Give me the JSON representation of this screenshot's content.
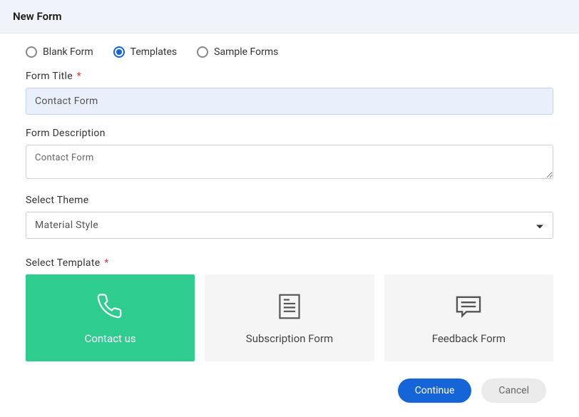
{
  "header": {
    "title": "New Form"
  },
  "formType": {
    "options": [
      {
        "label": "Blank Form",
        "selected": false
      },
      {
        "label": "Templates",
        "selected": true
      },
      {
        "label": "Sample Forms",
        "selected": false
      }
    ]
  },
  "fields": {
    "formTitle": {
      "label": "Form Title",
      "required": true,
      "value": "Contact Form"
    },
    "formDescription": {
      "label": "Form Description",
      "value": "Contact Form"
    },
    "selectTheme": {
      "label": "Select Theme",
      "value": "Material Style"
    },
    "selectTemplate": {
      "label": "Select Template",
      "required": true,
      "options": [
        {
          "name": "Contact us",
          "icon": "phone-icon",
          "selected": true
        },
        {
          "name": "Subscription Form",
          "icon": "document-icon",
          "selected": false
        },
        {
          "name": "Feedback Form",
          "icon": "chat-icon",
          "selected": false
        }
      ]
    }
  },
  "buttons": {
    "continue": "Continue",
    "cancel": "Cancel"
  },
  "requiredMark": "*"
}
